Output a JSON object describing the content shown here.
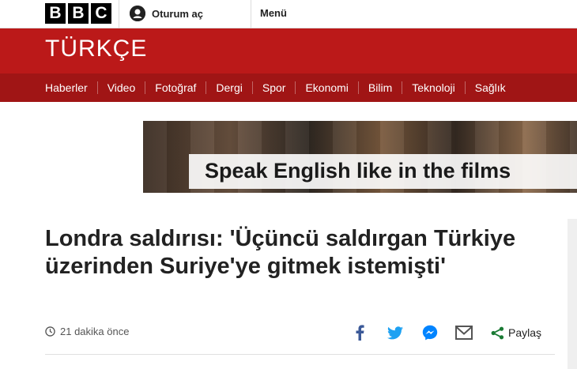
{
  "header": {
    "logo_letters": [
      "B",
      "B",
      "C"
    ],
    "signin_label": "Oturum aç",
    "menu_label": "Menü"
  },
  "brand": {
    "title": "TÜRKÇE",
    "color": "#bb1919"
  },
  "nav": {
    "items": [
      "Haberler",
      "Video",
      "Fotoğraf",
      "Dergi",
      "Spor",
      "Ekonomi",
      "Bilim",
      "Teknoloji",
      "Sağlık"
    ],
    "color": "#a01515"
  },
  "ad": {
    "text": "Speak English like in the films"
  },
  "article": {
    "headline": "Londra saldırısı: 'Üçüncü saldırgan Türkiye üzerinden Suriye'ye gitmek istemişti'",
    "timestamp": "21 dakika önce"
  },
  "share": {
    "icons": [
      "facebook-icon",
      "twitter-icon",
      "messenger-icon",
      "email-icon",
      "share-icon"
    ],
    "label": "Paylaş",
    "colors": {
      "facebook": "#3b5998",
      "twitter": "#1da1f2",
      "messenger": "#0084ff",
      "email": "#555555",
      "share": "#1a7a34"
    }
  }
}
